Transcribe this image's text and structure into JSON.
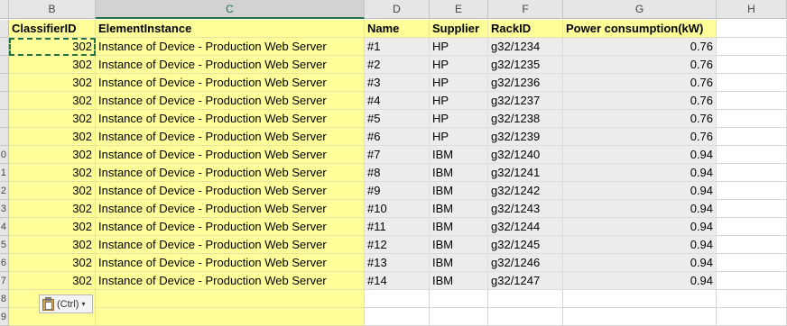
{
  "columns": [
    {
      "letter": "B",
      "header": "ClassifierID"
    },
    {
      "letter": "C",
      "header": "ElementInstance"
    },
    {
      "letter": "D",
      "header": "Name"
    },
    {
      "letter": "E",
      "header": "Supplier"
    },
    {
      "letter": "F",
      "header": "RackID"
    },
    {
      "letter": "G",
      "header": "Power consumption(kW)"
    },
    {
      "letter": "H",
      "header": ""
    }
  ],
  "row_numbers": [
    "",
    "",
    "",
    "",
    "",
    "",
    "",
    "0",
    "1",
    "2",
    "3",
    "4",
    "5",
    "6",
    "7",
    "8",
    "9"
  ],
  "rows": [
    {
      "classifier": "302",
      "instance": "Instance of Device - Production Web Server",
      "name": "#1",
      "supplier": "HP",
      "rack": "g32/1234",
      "power": "0.76"
    },
    {
      "classifier": "302",
      "instance": "Instance of Device - Production Web Server",
      "name": "#2",
      "supplier": "HP",
      "rack": "g32/1235",
      "power": "0.76"
    },
    {
      "classifier": "302",
      "instance": "Instance of Device - Production Web Server",
      "name": "#3",
      "supplier": "HP",
      "rack": "g32/1236",
      "power": "0.76"
    },
    {
      "classifier": "302",
      "instance": "Instance of Device - Production Web Server",
      "name": "#4",
      "supplier": "HP",
      "rack": "g32/1237",
      "power": "0.76"
    },
    {
      "classifier": "302",
      "instance": "Instance of Device - Production Web Server",
      "name": "#5",
      "supplier": "HP",
      "rack": "g32/1238",
      "power": "0.76"
    },
    {
      "classifier": "302",
      "instance": "Instance of Device - Production Web Server",
      "name": "#6",
      "supplier": "HP",
      "rack": "g32/1239",
      "power": "0.76"
    },
    {
      "classifier": "302",
      "instance": "Instance of Device - Production Web Server",
      "name": "#7",
      "supplier": "IBM",
      "rack": "g32/1240",
      "power": "0.94"
    },
    {
      "classifier": "302",
      "instance": "Instance of Device - Production Web Server",
      "name": "#8",
      "supplier": "IBM",
      "rack": "g32/1241",
      "power": "0.94"
    },
    {
      "classifier": "302",
      "instance": "Instance of Device - Production Web Server",
      "name": "#9",
      "supplier": "IBM",
      "rack": "g32/1242",
      "power": "0.94"
    },
    {
      "classifier": "302",
      "instance": "Instance of Device - Production Web Server",
      "name": "#10",
      "supplier": "IBM",
      "rack": "g32/1243",
      "power": "0.94"
    },
    {
      "classifier": "302",
      "instance": "Instance of Device - Production Web Server",
      "name": "#11",
      "supplier": "IBM",
      "rack": "g32/1244",
      "power": "0.94"
    },
    {
      "classifier": "302",
      "instance": "Instance of Device - Production Web Server",
      "name": "#12",
      "supplier": "IBM",
      "rack": "g32/1245",
      "power": "0.94"
    },
    {
      "classifier": "302",
      "instance": "Instance of Device - Production Web Server",
      "name": "#13",
      "supplier": "IBM",
      "rack": "g32/1246",
      "power": "0.94"
    },
    {
      "classifier": "302",
      "instance": "Instance of Device - Production Web Server",
      "name": "#14",
      "supplier": "IBM",
      "rack": "g32/1247",
      "power": "0.94"
    }
  ],
  "paste_options": {
    "label": "(Ctrl)",
    "icon": "clipboard-icon"
  },
  "colors": {
    "header_fill": "#ffff99",
    "data_fill": "#ececec",
    "accent": "#217346"
  }
}
